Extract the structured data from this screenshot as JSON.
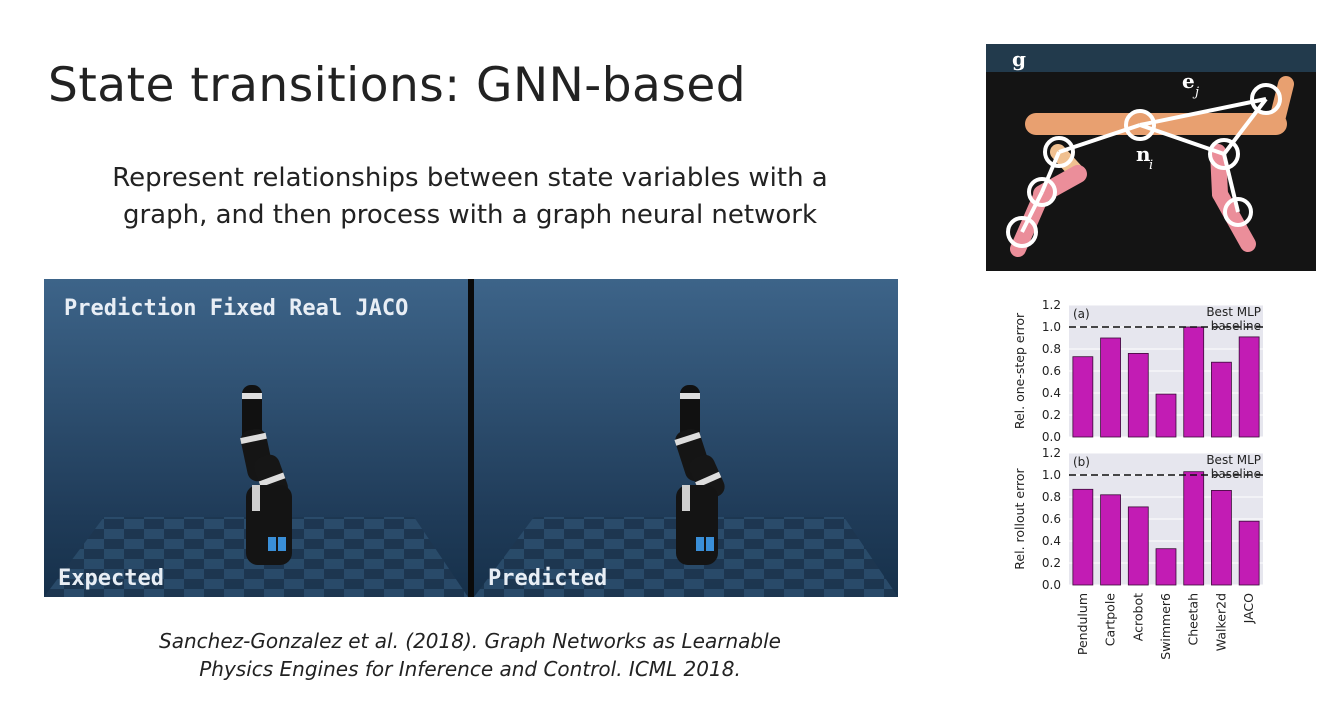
{
  "slide": {
    "title": "State transitions: GNN-based",
    "subtitle": "Represent relationships between state variables with a graph, and then process with a graph neural network",
    "citation_line1": "Sanchez-Gonzalez et al. (2018). Graph Networks as Learnable",
    "citation_line2": "Physics Engines for Inference and Control. ICML 2018."
  },
  "simulation": {
    "header": "Prediction Fixed Real JACO",
    "left_label": "Expected",
    "right_label": "Predicted"
  },
  "graph_figure": {
    "global_label": "g",
    "edge_label": "e",
    "edge_sub": "j",
    "node_label": "n",
    "node_sub": "i"
  },
  "chart_data": [
    {
      "type": "bar",
      "panel_label": "(a)",
      "ylabel": "Rel. one-step error",
      "ylim": [
        0,
        1.2
      ],
      "yticks": [
        "0.0",
        "0.2",
        "0.4",
        "0.6",
        "0.8",
        "1.0",
        "1.2"
      ],
      "reference_line": 1.0,
      "reference_label_line1": "Best MLP",
      "reference_label_line2": "baseline",
      "categories": [
        "Pendulum",
        "Cartpole",
        "Acrobot",
        "Swimmer6",
        "Cheetah",
        "Walker2d",
        "JACO"
      ],
      "values": [
        0.73,
        0.9,
        0.76,
        0.39,
        1.0,
        0.68,
        0.91
      ],
      "color": "#c21cb4",
      "grid": true
    },
    {
      "type": "bar",
      "panel_label": "(b)",
      "ylabel": "Rel. rollout error",
      "ylim": [
        0,
        1.2
      ],
      "yticks": [
        "0.0",
        "0.2",
        "0.4",
        "0.6",
        "0.8",
        "1.0",
        "1.2"
      ],
      "reference_line": 1.0,
      "reference_label_line1": "Best MLP",
      "reference_label_line2": "baseline",
      "categories": [
        "Pendulum",
        "Cartpole",
        "Acrobot",
        "Swimmer6",
        "Cheetah",
        "Walker2d",
        "JACO"
      ],
      "values": [
        0.87,
        0.82,
        0.71,
        0.33,
        1.03,
        0.86,
        0.58
      ],
      "color": "#c21cb4",
      "grid": true
    }
  ]
}
